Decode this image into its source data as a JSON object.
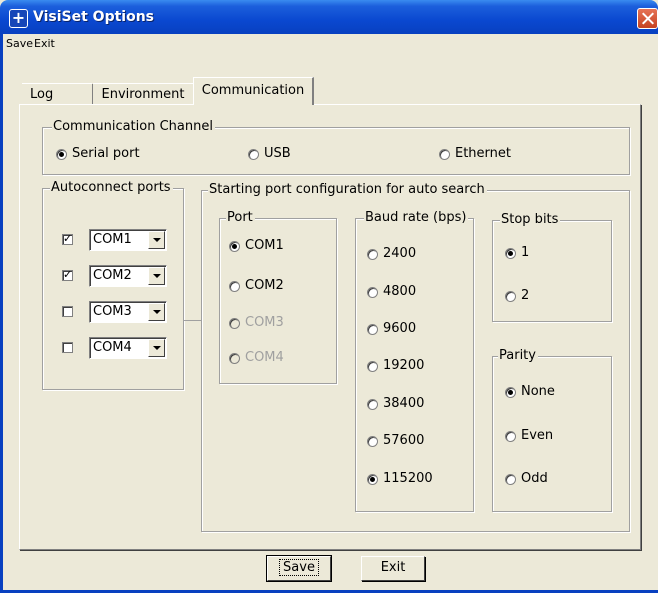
{
  "window": {
    "title": "VisiSet Options"
  },
  "menu": {
    "save": "Save",
    "exit": "Exit"
  },
  "tabs": [
    "Log",
    "Environment",
    "Communication"
  ],
  "active_tab": "Communication",
  "channel": {
    "title": "Communication Channel",
    "options": [
      "Serial port",
      "USB",
      "Ethernet"
    ],
    "selected": "Serial port"
  },
  "autoconnect": {
    "title": "Autoconnect ports",
    "ports": [
      {
        "checked": true,
        "value": "COM1"
      },
      {
        "checked": true,
        "value": "COM2"
      },
      {
        "checked": false,
        "value": "COM3"
      },
      {
        "checked": false,
        "value": "COM4"
      }
    ]
  },
  "starting": {
    "title": "Starting port configuration for auto search",
    "port": {
      "title": "Port",
      "options": [
        "COM1",
        "COM2",
        "COM3",
        "COM4"
      ],
      "disabled": [
        "COM3",
        "COM4"
      ],
      "selected": "COM1"
    },
    "baud": {
      "title": "Baud rate (bps)",
      "options": [
        "2400",
        "4800",
        "9600",
        "19200",
        "38400",
        "57600",
        "115200"
      ],
      "selected": "115200"
    },
    "stop_bits": {
      "title": "Stop bits",
      "options": [
        "1",
        "2"
      ],
      "selected": "1"
    },
    "parity": {
      "title": "Parity",
      "options": [
        "None",
        "Even",
        "Odd"
      ],
      "selected": "None"
    }
  },
  "buttons": {
    "save": "Save",
    "exit": "Exit"
  },
  "colors": {
    "titlebar": "#0a48d0",
    "face": "#ece9d8",
    "close": "#c64221"
  }
}
